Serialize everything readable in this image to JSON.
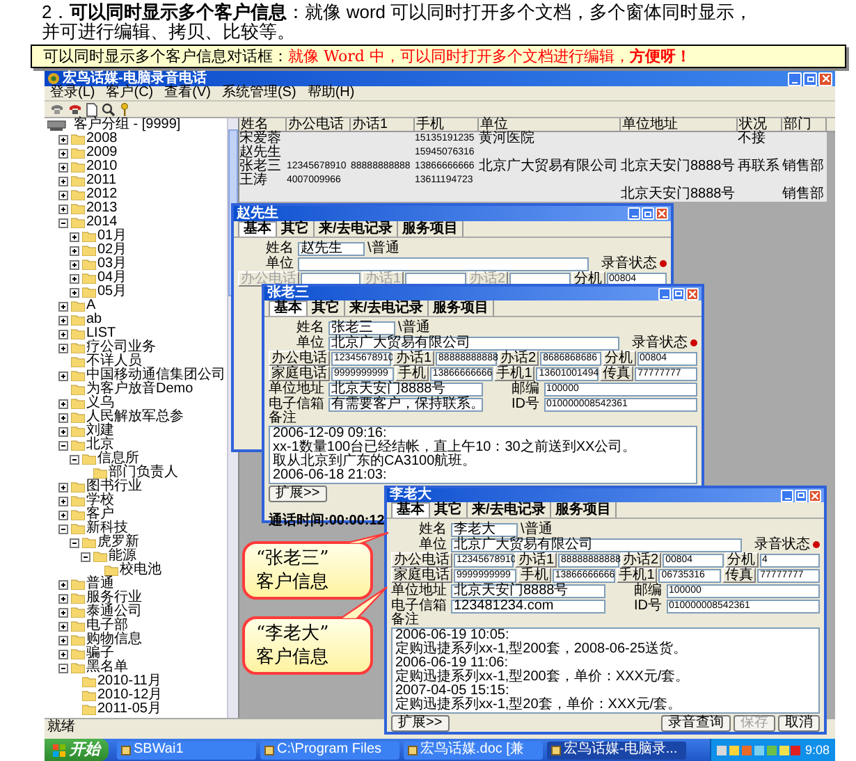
{
  "heading": "2．**可以同时显示多个客户信息**：就像 word 可以同时打开多个文档，多个窗体同时显示，并可进行编辑、拷贝、比较等。",
  "callout": [
    {
      "kind": "lead",
      "text": "可以同时显示多个客户信息对话框："
    },
    {
      "kind": "emphasis",
      "text": "就像 Word 中，可以同时打开多个文档进行编辑，"
    },
    {
      "kind": "strong",
      "text": "方便呀！"
    }
  ],
  "app": {
    "title": "宏鸟话媒-电脑录音电话",
    "menu": [
      "登录(L)",
      "客户(C)",
      "查看(V)",
      "系统管理(S)",
      "帮助(H)"
    ],
    "tree": {
      "label": "客户分组 - [9999]",
      "children": [
        {
          "label": "2008",
          "expanded": false
        },
        {
          "label": "2009",
          "expanded": false
        },
        {
          "label": "2010",
          "expanded": false
        },
        {
          "label": "2011",
          "expanded": false
        },
        {
          "label": "2012",
          "expanded": false
        },
        {
          "label": "2013",
          "expanded": false
        },
        {
          "label": "2014",
          "expanded": true,
          "children": [
            {
              "label": "01月",
              "expanded": false
            },
            {
              "label": "02月",
              "expanded": false
            },
            {
              "label": "03月",
              "expanded": false
            },
            {
              "label": "04月",
              "expanded": false
            },
            {
              "label": "05月",
              "expanded": false
            }
          ]
        },
        {
          "label": "A",
          "expanded": false
        },
        {
          "label": "ab",
          "expanded": false
        },
        {
          "label": "LIST",
          "expanded": false
        },
        {
          "label": "疗公司业务",
          "expanded": false
        },
        {
          "label": "不详人员"
        },
        {
          "label": "中国移动通信集团公司",
          "expanded": false
        },
        {
          "label": "为客户放音Demo"
        },
        {
          "label": "义乌",
          "expanded": false
        },
        {
          "label": "人民解放军总参",
          "expanded": false
        },
        {
          "label": "刘建",
          "expanded": false
        },
        {
          "label": "北京",
          "expanded": true,
          "children": [
            {
              "label": "信息所",
              "expanded": true,
              "children": [
                {
                  "label": "部门负责人"
                }
              ]
            }
          ]
        },
        {
          "label": "图书行业",
          "expanded": false
        },
        {
          "label": "学校",
          "expanded": false
        },
        {
          "label": "客户",
          "expanded": false
        },
        {
          "label": "新科技",
          "expanded": true,
          "children": [
            {
              "label": "虎罗新",
              "expanded": true,
              "children": [
                {
                  "label": "能源",
                  "expanded": true,
                  "children": [
                    {
                      "label": "校电池"
                    }
                  ]
                }
              ]
            }
          ]
        },
        {
          "label": "普通",
          "expanded": false
        },
        {
          "label": "服务行业",
          "expanded": false
        },
        {
          "label": "泰通公司",
          "expanded": false
        },
        {
          "label": "电子部",
          "expanded": false
        },
        {
          "label": "购物信息",
          "expanded": false
        },
        {
          "label": "骗子",
          "expanded": false
        },
        {
          "label": "黑名单",
          "expanded": true,
          "children": [
            {
              "label": "2010-11月"
            },
            {
              "label": "2010-12月"
            },
            {
              "label": "2011-05月"
            }
          ]
        }
      ]
    },
    "grid": {
      "columns": [
        {
          "label": "姓名",
          "kind": "text"
        },
        {
          "label": "办公电话",
          "kind": "number"
        },
        {
          "label": "办话1",
          "kind": "number"
        },
        {
          "label": "手机",
          "kind": "number"
        },
        {
          "label": "单位",
          "kind": "text"
        },
        {
          "label": "单位地址",
          "kind": "text"
        },
        {
          "label": "状况",
          "kind": "text"
        },
        {
          "label": "部门",
          "kind": "text"
        }
      ],
      "rows": [
        {
          "cells": [
            "宋爱蓉",
            null,
            null,
            "15135191235",
            "黄河医院",
            null,
            "不接",
            null
          ]
        },
        {
          "cells": [
            "赵先生",
            null,
            null,
            "15945076316",
            null,
            null,
            null,
            null
          ]
        },
        {
          "cells": [
            "张老三",
            "12345678910",
            "88888888888",
            "13866666666",
            "北京广大贸易有限公司",
            "北京天安门8888号",
            "再联系",
            "销售部"
          ]
        },
        {
          "cells": [
            "王涛",
            "4007009966",
            null,
            "13611194723",
            null,
            null,
            null,
            null
          ]
        },
        {
          "cells": [
            null,
            null,
            null,
            null,
            null,
            "北京天安门8888号",
            null,
            "销售部"
          ]
        }
      ]
    },
    "status": "就绪"
  },
  "dialogs": [
    {
      "title": "赵先生",
      "recording_status": {
        "label": "录音状态",
        "on": true
      },
      "tabs": [
        {
          "label": "基本",
          "selected": true
        },
        {
          "label": "其它",
          "selected": false
        },
        {
          "label": "来/去电记录",
          "selected": false
        },
        {
          "label": "服务项目",
          "selected": false
        }
      ],
      "rows": [
        [
          {
            "kind": "label",
            "text": "姓名"
          },
          {
            "kind": "field",
            "value": "赵先生"
          },
          {
            "kind": "text",
            "text": "\\普通"
          }
        ],
        [
          {
            "kind": "label",
            "text": "单位"
          },
          {
            "kind": "field"
          }
        ],
        [
          {
            "kind": "button",
            "text": "办公电话",
            "disabled": true
          },
          {
            "kind": "numfield"
          },
          {
            "kind": "button",
            "text": "办话1",
            "disabled": true
          },
          {
            "kind": "numfield"
          },
          {
            "kind": "button",
            "text": "办话2",
            "disabled": true
          },
          {
            "kind": "numfield"
          },
          {
            "kind": "button",
            "text": "分机",
            "disabled": false
          },
          {
            "kind": "numfield",
            "value": "00804"
          }
        ]
      ]
    },
    {
      "title": "张老三",
      "recording_status": {
        "label": "录音状态",
        "on": true
      },
      "tabs": [
        {
          "label": "基本",
          "selected": true
        },
        {
          "label": "其它",
          "selected": false
        },
        {
          "label": "来/去电记录",
          "selected": false
        },
        {
          "label": "服务项目",
          "selected": false
        }
      ],
      "rows": [
        [
          {
            "kind": "label",
            "text": "姓名"
          },
          {
            "kind": "field",
            "value": "张老三"
          },
          {
            "kind": "text",
            "text": "\\普通"
          }
        ],
        [
          {
            "kind": "label",
            "text": "单位"
          },
          {
            "kind": "field",
            "value": "北京广大贸易有限公司"
          }
        ],
        [
          {
            "kind": "button",
            "text": "办公电话",
            "disabled": false
          },
          {
            "kind": "numfield",
            "value": "12345678910"
          },
          {
            "kind": "button",
            "text": "办话1",
            "disabled": false
          },
          {
            "kind": "numfield",
            "value": "88888888888"
          },
          {
            "kind": "button",
            "text": "办话2",
            "disabled": false
          },
          {
            "kind": "numfield",
            "value": "8686868686"
          },
          {
            "kind": "button",
            "text": "分机",
            "disabled": false
          },
          {
            "kind": "numfield",
            "value": "00804"
          }
        ],
        [
          {
            "kind": "button",
            "text": "家庭电话",
            "disabled": false
          },
          {
            "kind": "numfield",
            "value": "9999999999"
          },
          {
            "kind": "button",
            "text": "手机",
            "disabled": false
          },
          {
            "kind": "numfield",
            "value": "13866666666"
          },
          {
            "kind": "button",
            "text": "手机1",
            "disabled": false
          },
          {
            "kind": "numfield",
            "value": "13601001494"
          },
          {
            "kind": "button",
            "text": "传真",
            "disabled": false
          },
          {
            "kind": "numfield",
            "value": "77777777"
          }
        ],
        [
          {
            "kind": "label",
            "text": "单位地址"
          },
          {
            "kind": "field",
            "value": "北京天安门8888号"
          },
          {
            "kind": "label",
            "text": "邮编"
          },
          {
            "kind": "numfield",
            "value": "100000"
          }
        ],
        [
          {
            "kind": "label",
            "text": "电子信箱"
          },
          {
            "kind": "field",
            "value": "有需要客户，保持联系。"
          },
          {
            "kind": "label",
            "text": "ID号"
          },
          {
            "kind": "numfield",
            "value": "010000008542361"
          }
        ]
      ],
      "note": {
        "label": "备注",
        "lines": [
          "2006-12-09 09:16:",
          "xx-1数量100台已经结帐，直上午10：30之前送到XX公司。",
          "取从北京到广东的CA3100航班。",
          "2006-06-18 21:03:"
        ]
      },
      "buttons": [
        {
          "text": "扩展>>",
          "disabled": false
        }
      ],
      "call_time": "通话时间:00:00:12"
    },
    {
      "title": "李老大",
      "recording_status": {
        "label": "录音状态",
        "on": true
      },
      "tabs": [
        {
          "label": "基本",
          "selected": true
        },
        {
          "label": "其它",
          "selected": false
        },
        {
          "label": "来/去电记录",
          "selected": false
        },
        {
          "label": "服务项目",
          "selected": false
        }
      ],
      "rows": [
        [
          {
            "kind": "label",
            "text": "姓名"
          },
          {
            "kind": "field",
            "value": "李老大"
          },
          {
            "kind": "text",
            "text": "\\普通"
          }
        ],
        [
          {
            "kind": "label",
            "text": "单位"
          },
          {
            "kind": "field",
            "value": "北京广大贸易有限公司"
          }
        ],
        [
          {
            "kind": "button",
            "text": "办公电话",
            "disabled": false
          },
          {
            "kind": "numfield",
            "value": "12345678910"
          },
          {
            "kind": "button",
            "text": "办话1",
            "disabled": false
          },
          {
            "kind": "numfield",
            "value": "88888888888"
          },
          {
            "kind": "button",
            "text": "办话2",
            "disabled": false
          },
          {
            "kind": "numfield",
            "value": "00804"
          },
          {
            "kind": "button",
            "text": "分机",
            "disabled": false
          },
          {
            "kind": "numfield",
            "value": "4"
          }
        ],
        [
          {
            "kind": "button",
            "text": "家庭电话",
            "disabled": false
          },
          {
            "kind": "numfield",
            "value": "9999999999"
          },
          {
            "kind": "button",
            "text": "手机",
            "disabled": false
          },
          {
            "kind": "numfield",
            "value": "13866666666"
          },
          {
            "kind": "button",
            "text": "手机1",
            "disabled": false
          },
          {
            "kind": "numfield",
            "value": "06735316"
          },
          {
            "kind": "button",
            "text": "传真",
            "disabled": false
          },
          {
            "kind": "numfield",
            "value": "77777777"
          }
        ],
        [
          {
            "kind": "label",
            "text": "单位地址"
          },
          {
            "kind": "field",
            "value": "北京天安门8888号"
          },
          {
            "kind": "label",
            "text": "邮编"
          },
          {
            "kind": "numfield",
            "value": "100000"
          }
        ],
        [
          {
            "kind": "label",
            "text": "电子信箱"
          },
          {
            "kind": "field",
            "value": "123481234.com"
          },
          {
            "kind": "label",
            "text": "ID号"
          },
          {
            "kind": "numfield",
            "value": "010000008542361"
          }
        ]
      ],
      "note": {
        "label": "备注",
        "lines": [
          "2006-06-19 10:05:",
          "定购迅捷系列xx-1,型200套，2008-06-25送货。",
          "2006-06-19 11:06:",
          "定购迅捷系列xx-1,型200套，单价：XXX元/套。",
          "2007-04-05 15:15:",
          "定购迅捷系列xx-1,型20套，单价：XXX元/套。"
        ]
      },
      "buttons": [
        {
          "text": "扩展>>",
          "disabled": false
        },
        {
          "text": "录音查询",
          "disabled": false
        },
        {
          "text": "保存",
          "disabled": true
        },
        {
          "text": "取消",
          "disabled": false
        }
      ]
    }
  ],
  "bubbles": [
    {
      "lines": [
        "“张老三”",
        "客户信息"
      ]
    },
    {
      "lines": [
        "“李老大”",
        "客户信息"
      ]
    }
  ],
  "taskbar": {
    "start": "开始",
    "items": [
      {
        "label": "SBWai1",
        "selected": false
      },
      {
        "label": "C:\\Program Files",
        "selected": false
      },
      {
        "label": "宏鸟话媒.doc [兼",
        "selected": false
      },
      {
        "label": "宏鸟话媒-电脑录...",
        "selected": true
      }
    ],
    "clock": "9:08"
  }
}
